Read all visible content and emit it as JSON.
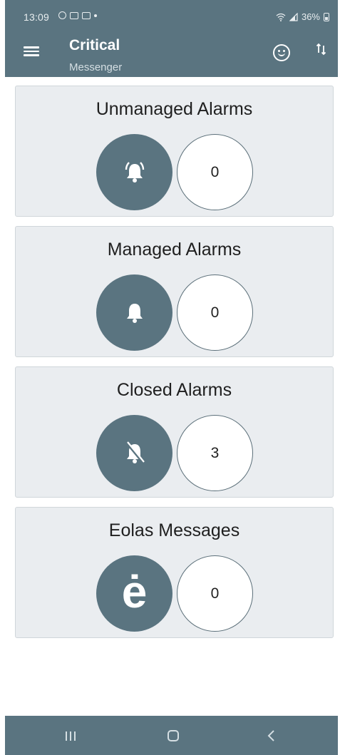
{
  "status_bar": {
    "time": "13:09",
    "battery": "36%"
  },
  "app_bar": {
    "title": "Critical",
    "subtitle": "Messenger"
  },
  "cards": [
    {
      "title": "Unmanaged Alarms",
      "icon": "bell-ringing-icon",
      "count": "0"
    },
    {
      "title": "Managed Alarms",
      "icon": "bell-icon",
      "count": "0"
    },
    {
      "title": "Closed Alarms",
      "icon": "bell-off-icon",
      "count": "3"
    },
    {
      "title": "Eolas Messages",
      "icon": "eolas-e-icon",
      "icon_glyph": "ė",
      "count": "0"
    }
  ],
  "colors": {
    "primary": "#5a7480",
    "card_bg": "#eaedf0"
  }
}
